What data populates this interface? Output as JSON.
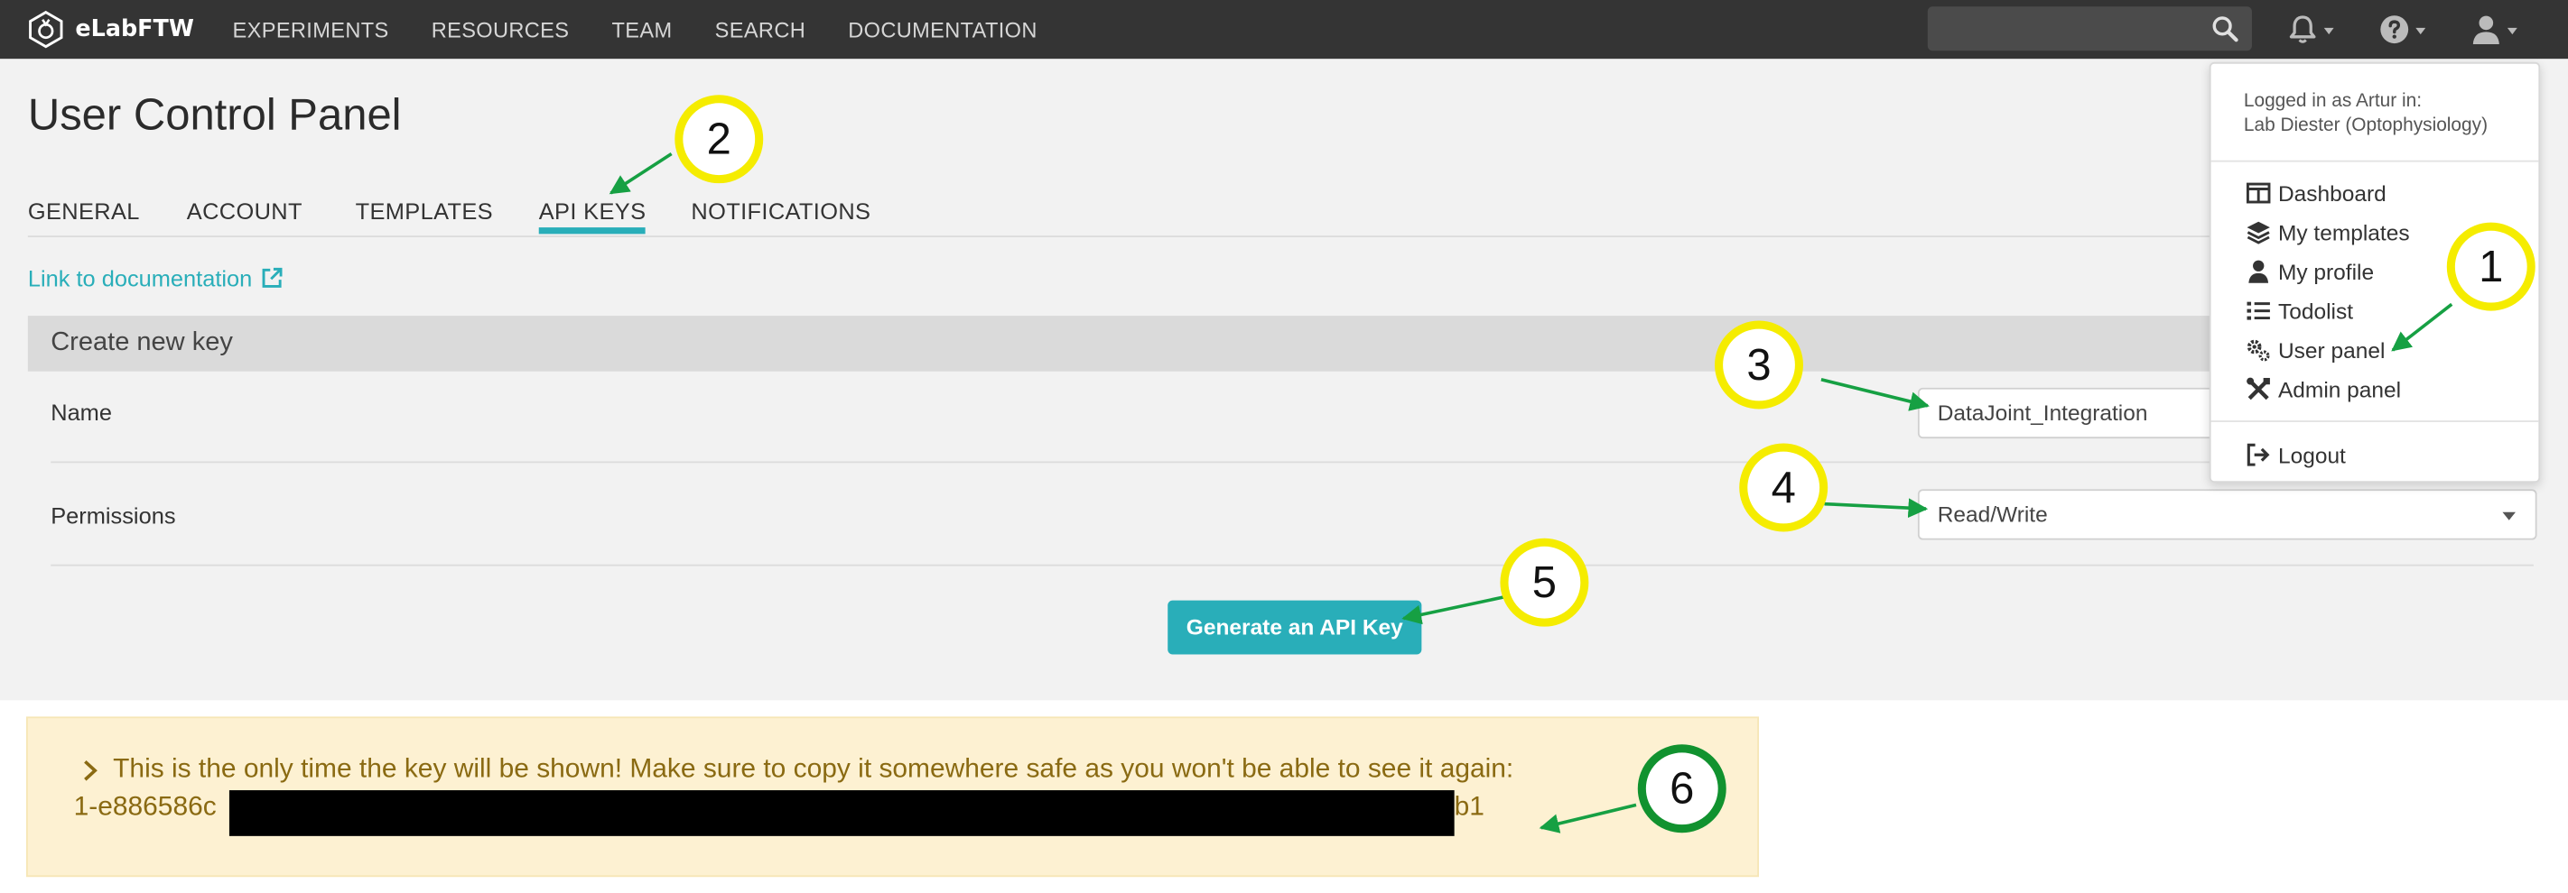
{
  "app": {
    "brand": "eLabFTW"
  },
  "nav": {
    "links": [
      "EXPERIMENTS",
      "RESOURCES",
      "TEAM",
      "SEARCH",
      "DOCUMENTATION"
    ],
    "search_placeholder": ""
  },
  "page": {
    "title": "User Control Panel",
    "tabs": [
      "GENERAL",
      "ACCOUNT",
      "TEMPLATES",
      "API KEYS",
      "NOTIFICATIONS"
    ],
    "active_tab": "API KEYS",
    "doc_link": "Link to documentation"
  },
  "api_form": {
    "header": "Create new key",
    "name_label": "Name",
    "name_value": "DataJoint_Integration",
    "permissions_label": "Permissions",
    "permissions_value": "Read/Write",
    "generate_button": "Generate an API Key"
  },
  "alert": {
    "message": "This is the only time the key will be shown! Make sure to copy it somewhere safe as you won't be able to see it again:",
    "key_prefix": "1-e886586c",
    "key_suffix": "b1"
  },
  "user_menu": {
    "logged_in_line1": "Logged in as Artur in:",
    "logged_in_line2": "Lab Diester (Optophysiology)",
    "items": [
      "Dashboard",
      "My templates",
      "My profile",
      "Todolist",
      "User panel",
      "Admin panel"
    ],
    "logout": "Logout"
  },
  "annotations": {
    "step1": "1",
    "step2": "2",
    "step3": "3",
    "step4": "4",
    "step5": "5",
    "step6": "6"
  },
  "colors": {
    "navbar": "#343434",
    "accent": "#29aeb9",
    "alert_bg": "#fdf1d2",
    "alert_text": "#8a6a12",
    "badge_yellow": "#f5ec00",
    "badge_green": "#11922f",
    "arrow_green": "#16a043"
  }
}
